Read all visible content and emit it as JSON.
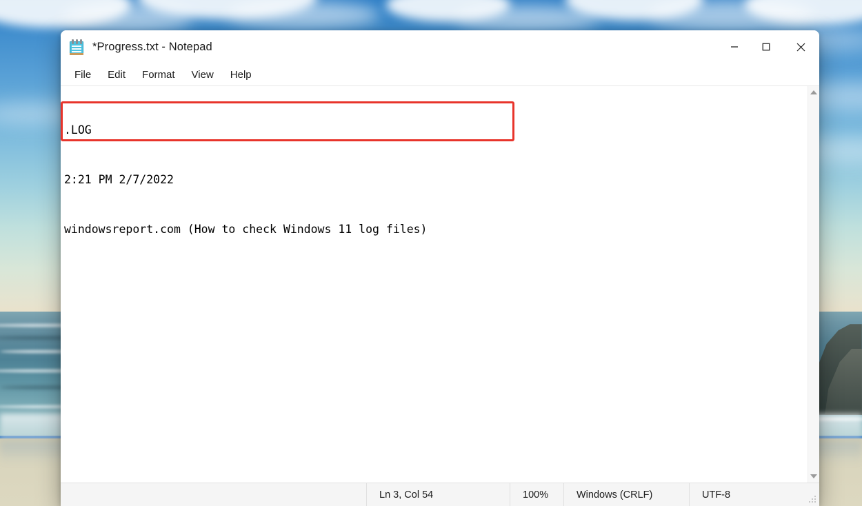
{
  "window": {
    "title": "*Progress.txt - Notepad",
    "app_icon": "notepad-icon",
    "controls": {
      "minimize": "minimize-icon",
      "maximize": "maximize-icon",
      "close": "close-icon"
    }
  },
  "menubar": {
    "items": [
      {
        "label": "File"
      },
      {
        "label": "Edit"
      },
      {
        "label": "Format"
      },
      {
        "label": "View"
      },
      {
        "label": "Help"
      }
    ]
  },
  "editor": {
    "lines": [
      ".LOG",
      "2:21 PM 2/7/2022",
      "windowsreport.com (How to check Windows 11 log files)"
    ],
    "annotation": {
      "shape": "rectangle",
      "color": "#e8342b",
      "covers_lines": [
        2,
        3
      ]
    },
    "scrollbar": {
      "up_arrow": "scroll-up-icon",
      "down_arrow": "scroll-down-icon"
    }
  },
  "statusbar": {
    "cursor_position": "Ln 3, Col 54",
    "zoom": "100%",
    "line_ending": "Windows (CRLF)",
    "encoding": "UTF-8"
  },
  "desktop": {
    "wallpaper": "beach-cliff-ocean"
  },
  "colors": {
    "annotation_red": "#e8342b",
    "window_bg": "#ffffff",
    "statusbar_bg": "#f5f5f5",
    "text": "#000000"
  }
}
